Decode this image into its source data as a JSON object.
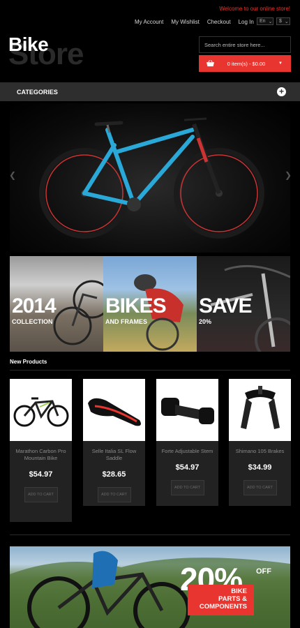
{
  "header": {
    "welcome": "Welcome to our online store!",
    "links": [
      "My Account",
      "My Wishlist",
      "Checkout",
      "Log In"
    ],
    "language": "En",
    "currency": "$"
  },
  "logo": {
    "front": "Bike",
    "back": "Store"
  },
  "search": {
    "placeholder": "Search entire store here..."
  },
  "cart": {
    "label": "0 item(s) - $0.00"
  },
  "categories": {
    "label": "CATEGORIES"
  },
  "banners": [
    {
      "big": "2014",
      "small": "COLLECTION"
    },
    {
      "big": "BIKES",
      "small": "AND FRAMES"
    },
    {
      "big": "SAVE",
      "small": "20%"
    }
  ],
  "new_products": {
    "title": "New Products",
    "items": [
      {
        "name": "Marathon Carbon Pro Mountain Bike",
        "price": "$54.97",
        "button": "ADD TO CART"
      },
      {
        "name": "Selle Italia SL Flow Saddle",
        "price": "$28.65",
        "button": "ADD TO CART"
      },
      {
        "name": "Forte Adjustable Stem",
        "price": "$54.97",
        "button": "ADD TO CART"
      },
      {
        "name": "Shimano 105 Brakes",
        "price": "$34.99",
        "button": "ADD TO CART"
      }
    ]
  },
  "promo": {
    "percent": "20%",
    "off": "OFF",
    "line1": "BIKE",
    "line2": "PARTS &",
    "line3": "COMPONENTS"
  },
  "colors": {
    "accent": "#e8352f",
    "bar": "#2e2e2e",
    "card": "#222222"
  }
}
